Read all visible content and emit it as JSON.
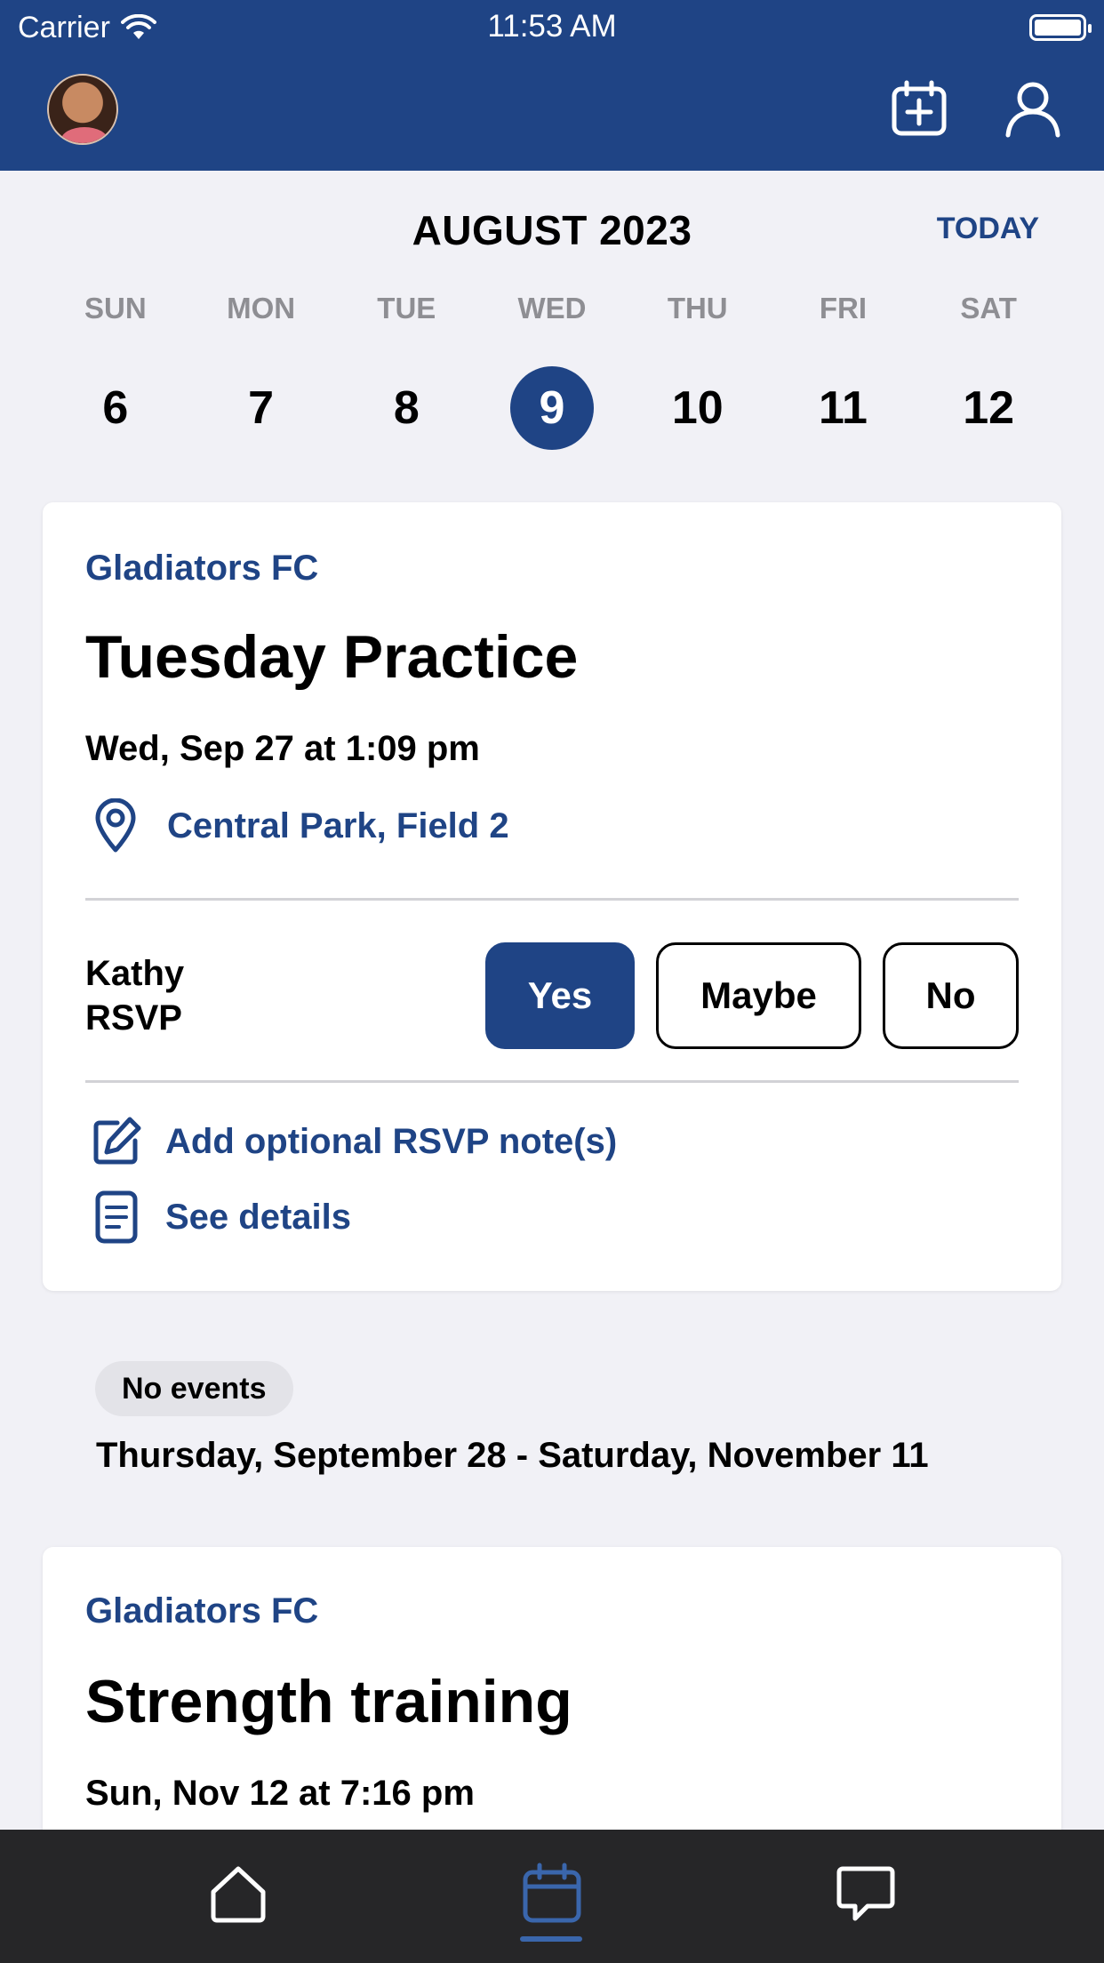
{
  "status_bar": {
    "carrier": "Carrier",
    "time": "11:53 AM"
  },
  "header": {
    "avatar": "user-avatar",
    "icons": [
      "calendar-add-icon",
      "profile-icon"
    ]
  },
  "calendar": {
    "month_title": "AUGUST 2023",
    "today_label": "TODAY",
    "days": [
      {
        "dow": "SUN",
        "num": "6",
        "selected": false
      },
      {
        "dow": "MON",
        "num": "7",
        "selected": false
      },
      {
        "dow": "TUE",
        "num": "8",
        "selected": false
      },
      {
        "dow": "WED",
        "num": "9",
        "selected": true
      },
      {
        "dow": "THU",
        "num": "10",
        "selected": false
      },
      {
        "dow": "FRI",
        "num": "11",
        "selected": false
      },
      {
        "dow": "SAT",
        "num": "12",
        "selected": false
      }
    ]
  },
  "event1": {
    "team": "Gladiators FC",
    "title": "Tuesday Practice",
    "datetime": "Wed, Sep 27 at 1:09 pm",
    "location": "Central Park, Field 2",
    "rsvp_label": "Kathy RSVP",
    "rsvp_options": {
      "yes": "Yes",
      "maybe": "Maybe",
      "no": "No"
    },
    "rsvp_selected": "Yes",
    "add_note": "Add optional RSVP note(s)",
    "see_details": "See details"
  },
  "no_events": {
    "badge": "No events",
    "range": "Thursday, September 28 - Saturday, November 11"
  },
  "event2": {
    "team": "Gladiators FC",
    "title": "Strength training",
    "datetime": "Sun, Nov 12 at 7:16 pm"
  },
  "tabbar": {
    "tabs": [
      "home-icon",
      "calendar-icon",
      "chat-icon"
    ],
    "active": "calendar-icon"
  },
  "colors": {
    "brand": "#1f4485",
    "background": "#f1f1f6",
    "tabbar": "#262628"
  }
}
